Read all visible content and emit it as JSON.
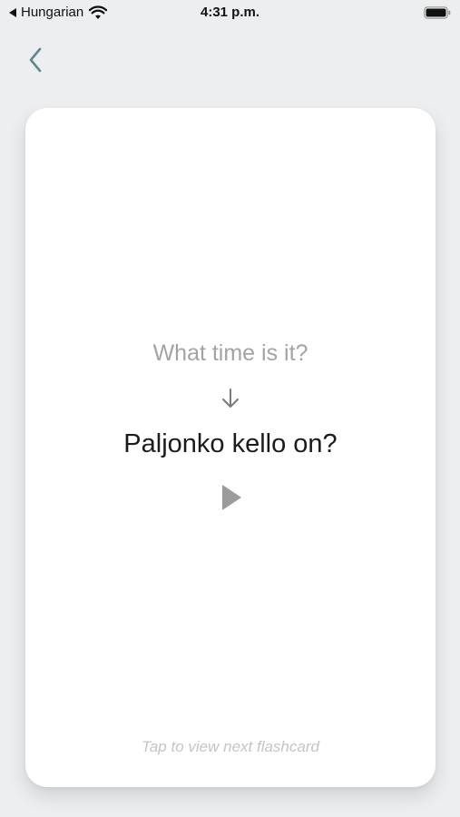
{
  "status_bar": {
    "back_app_label": "Hungarian",
    "time": "4:31 p.m.",
    "icons": [
      "back-app-caret",
      "wifi-icon",
      "battery-icon"
    ]
  },
  "nav": {
    "back_icon": "chevron-left-icon"
  },
  "card": {
    "prompt": "What time is it?",
    "arrow_icon": "arrow-down-icon",
    "translation": "Paljonko kello on?",
    "play_icon": "play-icon",
    "hint": "Tap to view next flashcard"
  },
  "colors": {
    "background": "#eceef0",
    "card": "#ffffff",
    "accent_back": "#5b8a91",
    "prompt_text": "#a3a3a3",
    "translation_text": "#1b1b1b",
    "play_icon": "#9b9b9b",
    "hint_text": "#c4c4c4"
  }
}
